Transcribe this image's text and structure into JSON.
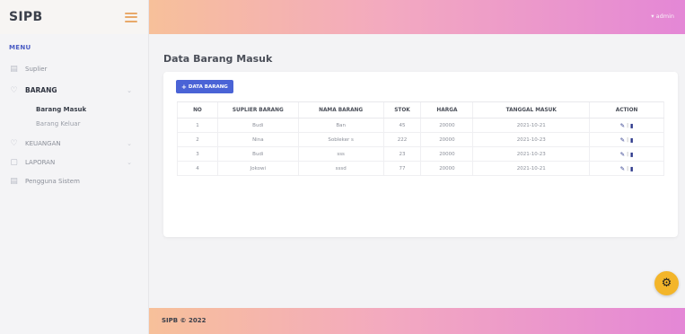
{
  "app": {
    "brand": "SIPB",
    "user_label": "admin"
  },
  "sidebar": {
    "heading": "MENU",
    "items": [
      {
        "label": "Suplier",
        "icon": "supplier-icon"
      },
      {
        "label": "BARANG",
        "icon": "box-icon",
        "expanded": true,
        "children": [
          {
            "label": "Barang Masuk",
            "active": true
          },
          {
            "label": "Barang Keluar",
            "active": false
          }
        ]
      },
      {
        "label": "KEUANGAN",
        "icon": "finance-icon"
      },
      {
        "label": "LAPORAN",
        "icon": "report-icon"
      },
      {
        "label": "Pengguna Sistem",
        "icon": "users-icon"
      }
    ]
  },
  "main": {
    "title": "Data Barang Masuk",
    "add_button": "DATA BARANG",
    "table": {
      "columns": [
        "NO",
        "SUPLIER BARANG",
        "NAMA BARANG",
        "STOK",
        "HARGA",
        "TANGGAL MASUK",
        "ACTION"
      ],
      "rows": [
        [
          "1",
          "Budi",
          "Ban",
          "45",
          "20000",
          "2021-10-21"
        ],
        [
          "2",
          "Nina",
          "Sobleker s",
          "222",
          "20000",
          "2021-10-23"
        ],
        [
          "3",
          "Budi",
          "sss",
          "23",
          "20000",
          "2021-10-23"
        ],
        [
          "4",
          "Jokowi",
          "sssd",
          "77",
          "20000",
          "2021-10-21"
        ]
      ]
    }
  },
  "footer": {
    "text": "SIPB © 2022"
  },
  "colors": {
    "accent": "#4a63d6",
    "fab": "#f3b52a",
    "gradient_start": "#f7c09a",
    "gradient_end": "#e487d6"
  }
}
